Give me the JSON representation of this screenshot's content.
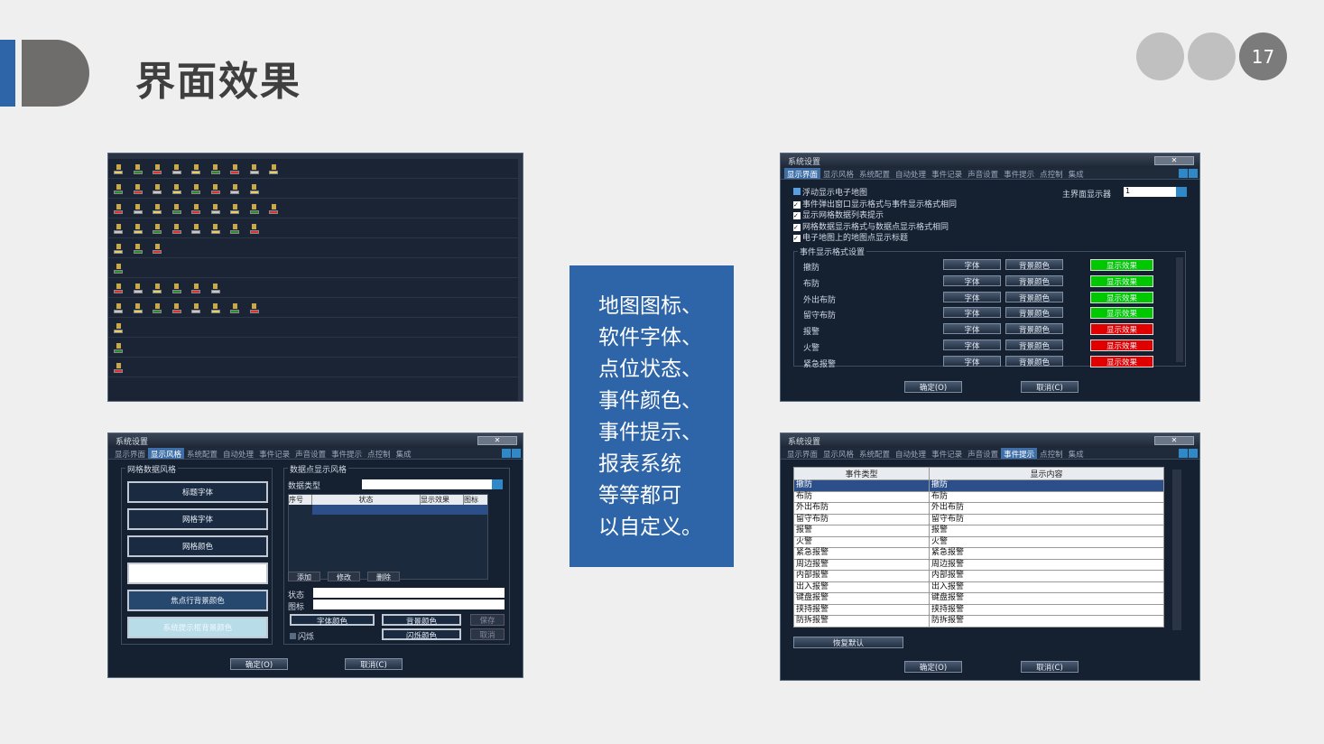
{
  "slide": {
    "title": "界面效果",
    "page_number": "17"
  },
  "description_lines": [
    "地图图标、",
    "软件字体、",
    "点位状态、",
    "事件颜色、",
    "事件提示、",
    "报表系统",
    "等等都可",
    "以自定义。"
  ],
  "colors": {
    "accent_blue": "#2e64a8",
    "dark_gray": "#6f6c6c",
    "green": "#00c800",
    "red": "#e00000"
  },
  "tabs": [
    "显示界面",
    "显示风格",
    "系统配置",
    "自动处理",
    "事件记录",
    "声音设置",
    "事件提示",
    "点控制",
    "集成"
  ],
  "win_display": {
    "title": "系统设置",
    "checkboxes": [
      "浮动显示电子地图",
      "事件弹出窗口显示格式与事件显示格式相同",
      "显示网格数据列表提示",
      "网格数据显示格式与数据点显示格式相同",
      "电子地图上的地图点显示标题"
    ],
    "main_display_label": "主界面显示器",
    "main_display_value": "1",
    "group_label": "事件显示格式设置",
    "rows": [
      {
        "name": "撤防",
        "font": "字体",
        "bg": "背景颜色",
        "effect": "显示效果",
        "color": "#00c800"
      },
      {
        "name": "布防",
        "font": "字体",
        "bg": "背景颜色",
        "effect": "显示效果",
        "color": "#00c800"
      },
      {
        "name": "外出布防",
        "font": "字体",
        "bg": "背景颜色",
        "effect": "显示效果",
        "color": "#00c800"
      },
      {
        "name": "留守布防",
        "font": "字体",
        "bg": "背景颜色",
        "effect": "显示效果",
        "color": "#00c800"
      },
      {
        "name": "报警",
        "font": "字体",
        "bg": "背景颜色",
        "effect": "显示效果",
        "color": "#e00000"
      },
      {
        "name": "火警",
        "font": "字体",
        "bg": "背景颜色",
        "effect": "显示效果",
        "color": "#e00000"
      },
      {
        "name": "紧急报警",
        "font": "字体",
        "bg": "背景颜色",
        "effect": "显示效果",
        "color": "#e00000"
      }
    ],
    "ok": "确定(O)",
    "cancel": "取消(C)"
  },
  "win_style": {
    "title": "系统设置",
    "grid_group": "网格数据风格",
    "grid_buttons": [
      "标题字体",
      "网格字体",
      "网格颜色",
      "",
      "焦点行背景颜色",
      "系统提示框背景颜色"
    ],
    "point_group": "数据点显示风格",
    "data_type_label": "数据类型",
    "cols": [
      "序号",
      "状态",
      "显示效果",
      "图标"
    ],
    "add": "添加",
    "edit": "修改",
    "del": "删除",
    "status_label": "状态",
    "icon_label": "图标",
    "font_color": "字体颜色",
    "bg_color": "背景颜色",
    "save": "保存",
    "flash": "闪烁",
    "flash_color": "闪烁颜色",
    "cancel_small": "取消",
    "ok": "确定(O)",
    "cancel": "取消(C)"
  },
  "win_prompt": {
    "title": "系统设置",
    "col_type": "事件类型",
    "col_content": "显示内容",
    "rows": [
      [
        "撤防",
        "撤防"
      ],
      [
        "布防",
        "布防"
      ],
      [
        "外出布防",
        "外出布防"
      ],
      [
        "留守布防",
        "留守布防"
      ],
      [
        "报警",
        "报警"
      ],
      [
        "火警",
        "火警"
      ],
      [
        "紧急报警",
        "紧急报警"
      ],
      [
        "周边报警",
        "周边报警"
      ],
      [
        "内部报警",
        "内部报警"
      ],
      [
        "出入报警",
        "出入报警"
      ],
      [
        "键盘报警",
        "键盘报警"
      ],
      [
        "挟持报警",
        "挟持报警"
      ],
      [
        "防拆报警",
        "防拆报警"
      ]
    ],
    "restore": "恢复默认",
    "ok": "确定(O)",
    "cancel": "取消(C)"
  }
}
